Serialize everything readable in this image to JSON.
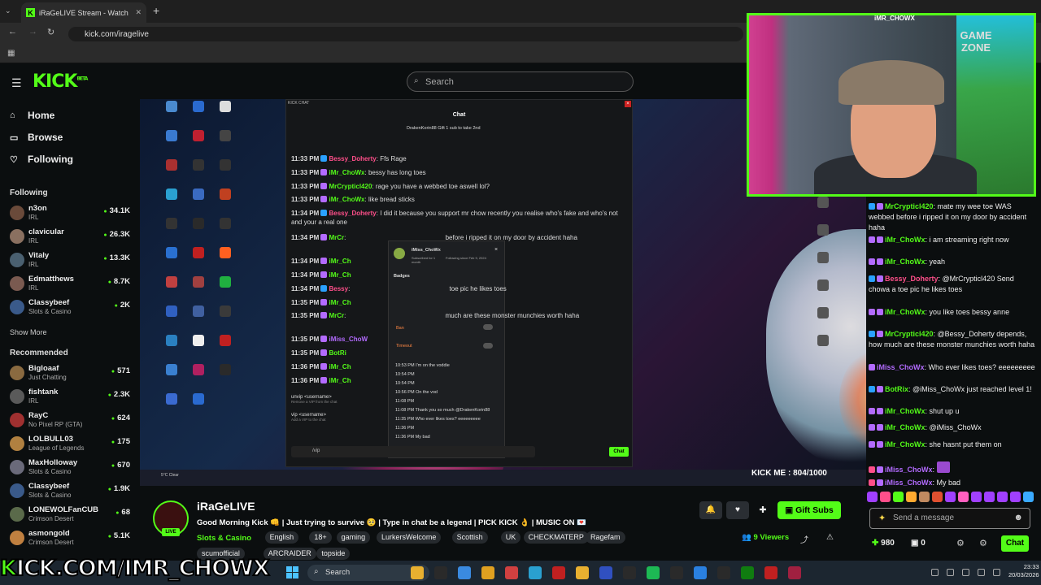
{
  "browser": {
    "tab_title": "iRaGeLIVE Stream - Watch",
    "url": "kick.com/iragelive"
  },
  "header": {
    "logo": "KICK",
    "logo_sup": "BETA",
    "search_placeholder": "Search"
  },
  "sidebar": {
    "nav": [
      {
        "label": "Home"
      },
      {
        "label": "Browse"
      },
      {
        "label": "Following"
      }
    ],
    "following_header": "Following",
    "following": [
      {
        "name": "n3on",
        "game": "IRL",
        "viewers": "34.1K"
      },
      {
        "name": "clavicular",
        "game": "IRL",
        "viewers": "26.3K"
      },
      {
        "name": "Vitaly",
        "game": "IRL",
        "viewers": "13.3K"
      },
      {
        "name": "Edmatthews",
        "game": "IRL",
        "viewers": "8.7K"
      },
      {
        "name": "Classybeef",
        "game": "Slots & Casino",
        "viewers": "2K"
      }
    ],
    "show_more": "Show More",
    "recommended_header": "Recommended",
    "recommended": [
      {
        "name": "Bigloaaf",
        "game": "Just Chatting",
        "viewers": "571"
      },
      {
        "name": "fishtank",
        "game": "IRL",
        "viewers": "2.3K"
      },
      {
        "name": "RayC",
        "game": "No Pixel RP (GTA)",
        "viewers": "624"
      },
      {
        "name": "LOLBULL03",
        "game": "League of Legends",
        "viewers": "175"
      },
      {
        "name": "MaxHolloway",
        "game": "Slots & Casino",
        "viewers": "670"
      },
      {
        "name": "Classybeef",
        "game": "Slots & Casino",
        "viewers": "1.9K"
      },
      {
        "name": "LONEWOLFanCUB",
        "game": "Crimson Desert",
        "viewers": "68"
      },
      {
        "name": "asmongold",
        "game": "Crimson Desert",
        "viewers": "5.1K"
      }
    ]
  },
  "video": {
    "kick_chat_title": "KICK CHAT",
    "chat_header": "Chat",
    "pinned": "DrakenKorin88  Gift 1 sub to take 2nd",
    "messages": [
      {
        "time": "11:33 PM",
        "user": "Bessy_Doherty",
        "color": "pink",
        "text": "Ffs Rage"
      },
      {
        "time": "11:33 PM",
        "user": "iMr_ChoWx",
        "color": "green",
        "text": "bessy has long toes"
      },
      {
        "time": "11:33 PM",
        "user": "MrCrypticl420",
        "color": "green",
        "text": "rage you have a webbed toe aswell lol?"
      },
      {
        "time": "11:33 PM",
        "user": "iMr_ChoWx",
        "color": "green",
        "text": "like bread sticks"
      },
      {
        "time": "11:34 PM",
        "user": "Bessy_Doherty",
        "color": "pink",
        "text": "I did it because you support mr chow recently you realise who's fake and who's not and your a real one"
      },
      {
        "time": "11:34 PM",
        "user": "MrCr",
        "color": "green",
        "text": "before i ripped it on my door by accident haha"
      },
      {
        "time": "11:34 PM",
        "user": "iMr_Ch",
        "color": "green",
        "text": ""
      },
      {
        "time": "11:34 PM",
        "user": "iMr_Ch",
        "color": "green",
        "text": ""
      },
      {
        "time": "11:34 PM",
        "user": "Bessy",
        "color": "pink",
        "text": "toe pic he likes toes"
      },
      {
        "time": "11:35 PM",
        "user": "iMr_Ch",
        "color": "green",
        "text": ""
      },
      {
        "time": "11:35 PM",
        "user": "MrCr",
        "color": "green",
        "text": "much are these monster munchies worth haha"
      },
      {
        "time": "11:35 PM",
        "user": "iMiss_ChoW",
        "color": "purple",
        "text": ""
      },
      {
        "time": "11:35 PM",
        "user": "BotRi",
        "color": "green",
        "text": ""
      },
      {
        "time": "11:36 PM",
        "user": "iMr_Ch",
        "color": "green",
        "text": ""
      },
      {
        "time": "11:36 PM",
        "user": "iMr_Ch",
        "color": "green",
        "text": ""
      }
    ],
    "user_card": {
      "name": "iMiss_ChoWx",
      "sub": "Subscribed for 1 month",
      "following": "Following since Feb 9, 2024",
      "badges": "Badges",
      "ban": "Ban",
      "timeout": "Timeout",
      "log": [
        "10:53 PM I'm on the voddie",
        "10:54 PM",
        "10:54 PM",
        "10:56 PM On the vod",
        "11:08 PM",
        "11:08 PM Thank you so much @DrakenKorin88",
        "11:35 PM Who ever likes toes? eeeeeeeee",
        "11:36 PM",
        "11:36 PM My bad"
      ]
    },
    "cmd_unvip": "unvip <username>",
    "cmd_unvip_desc": "Remove a VIP from the chat",
    "cmd_vip": "vip <username>",
    "cmd_vip_desc": "Add a VIP to the chat",
    "input_text": "/vip",
    "chat_button": "Chat",
    "kick_me": "KICK ME : 804/1000",
    "weather": "5°C Clear"
  },
  "webcam": {
    "label": "iMR_CHOWX",
    "sign": "GAME ZONE"
  },
  "right_chat": {
    "messages": [
      {
        "user": "MrCrypticl420",
        "color": "green",
        "badge": "b",
        "text": "mate my wee toe WAS webbed before i ripped it on my door by accident haha"
      },
      {
        "user": "iMr_ChoWx",
        "color": "green",
        "badge": "p",
        "text": "i am streaming right now"
      },
      {
        "user": "iMr_ChoWx",
        "color": "green",
        "badge": "p",
        "text": "yeah"
      },
      {
        "user": "Bessy_Doherty",
        "color": "pink",
        "badge": "b",
        "text": "@MrCrypticl420 Send chowa a toe pic he likes toes"
      },
      {
        "user": "iMr_ChoWx",
        "color": "green",
        "badge": "p",
        "text": "you like toes bessy anne"
      },
      {
        "user": "MrCrypticl420",
        "color": "green",
        "badge": "b",
        "text": "@Bessy_Doherty depends, how much are these monster munchies worth haha"
      },
      {
        "user": "iMiss_ChoWx",
        "color": "purple",
        "badge": "",
        "text": "Who ever likes toes? eeeeeeeee"
      },
      {
        "user": "BotRix",
        "color": "green",
        "badge": "b",
        "text": "@iMiss_ChoWx just reached level 1!"
      },
      {
        "user": "iMr_ChoWx",
        "color": "green",
        "badge": "p",
        "text": "shut up u"
      },
      {
        "user": "iMr_ChoWx",
        "color": "green",
        "badge": "p",
        "text": "@iMiss_ChoWx"
      },
      {
        "user": "iMr_ChoWx",
        "color": "green",
        "badge": "p",
        "text": "she hasnt put them on"
      },
      {
        "user": "iMiss_ChoWx",
        "color": "purple",
        "badge": "pk",
        "text": ""
      },
      {
        "user": "iMiss_ChoWx",
        "color": "purple",
        "badge": "pk",
        "text": "My bad"
      }
    ],
    "input_placeholder": "Send a message",
    "points": "980",
    "count": "0",
    "send_button": "Chat"
  },
  "stream": {
    "name": "iRaGeLIVE",
    "live": "LIVE",
    "title": "Good Morning Kick 👊 | Just trying to survive 🥺 | Type in chat be a legend | PICK KICK 👌 | MUSIC ON 💌",
    "category": "Slots & Casino",
    "tags": [
      "English",
      "18+",
      "gaming",
      "LurkersWelcome",
      "Scottish",
      "UK",
      "CHECKMATERP",
      "Ragefam",
      "scumofficial",
      "ARCRAIDER",
      "topside"
    ],
    "gift_subs": "Gift Subs",
    "viewers_count": "9",
    "viewers_label": "Viewers"
  },
  "overlay": {
    "text_k": "K",
    "text_rest": "ICK.COM/IMR_CHOWX"
  },
  "taskbar": {
    "search": "Search",
    "time": "23:33",
    "date": "20/03/2026"
  }
}
